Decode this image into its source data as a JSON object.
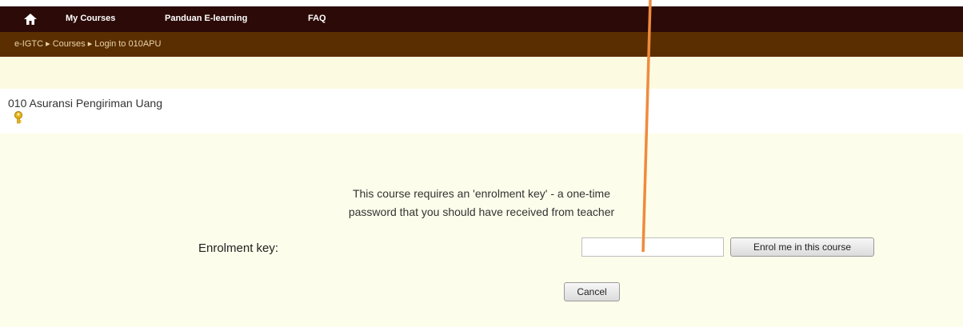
{
  "nav": {
    "links": [
      "My Courses",
      "Panduan E-learning",
      "FAQ"
    ]
  },
  "breadcrumb": "e-IGTC ▸ Courses ▸ Login to 010APU",
  "course": {
    "title": "010 Asuransi Pengiriman Uang"
  },
  "enrol": {
    "message_line1": "This course requires an 'enrolment key' - a one-time",
    "message_line2": "password that you should have received from teacher",
    "key_label": "Enrolment key:",
    "key_value": "",
    "submit_label": "Enrol me in this course",
    "cancel_label": "Cancel"
  },
  "colors": {
    "navbar": "#2b0a08",
    "breadcrumb_bar": "#5a2e00",
    "page_bg": "#fdfdeb",
    "annotation_arrow": "#f08a3c"
  },
  "icons": [
    "home-icon",
    "key-icon"
  ]
}
